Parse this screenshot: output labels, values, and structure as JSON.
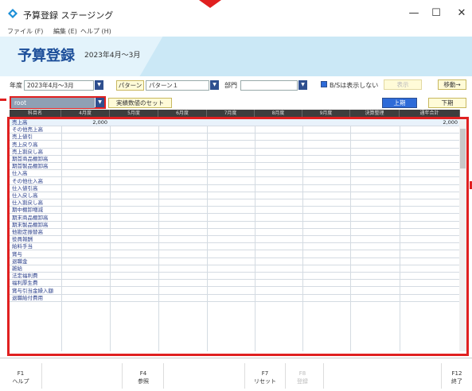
{
  "window": {
    "title": "予算登録 ステージング",
    "controls": {
      "minimize": "—",
      "maximize": "☐",
      "close": "✕"
    }
  },
  "menu": [
    {
      "label": "ファイル (F)"
    },
    {
      "label": "編集 (E)"
    },
    {
      "label": "ヘルプ (H)"
    }
  ],
  "header": {
    "title": "予算登録",
    "period": "2023年4月～3月"
  },
  "filters": {
    "year_label": "年度",
    "year_value": "2023年4月～3月",
    "pattern_label": "パターン",
    "pattern_value": "パターン１",
    "dept_label": "部門",
    "dept_value": "",
    "bs_hide_label": "B/Sは表示しない",
    "display_button": "表示",
    "move_button": "移動→"
  },
  "toolbar": {
    "tree_value": "root",
    "actual_set_button": "実績数値のセット",
    "upper_button": "上期",
    "lower_button": "下期"
  },
  "table": {
    "columns": [
      "科目名",
      "4月度",
      "5月度",
      "6月度",
      "7月度",
      "8月度",
      "9月度",
      "決算整理",
      "通年合計"
    ],
    "rows": [
      {
        "name": "売上高",
        "apr": "2,000",
        "total": "2,000"
      },
      {
        "name": "その他売上高",
        "apr": "",
        "total": ""
      },
      {
        "name": "売上値引",
        "apr": "",
        "total": ""
      },
      {
        "name": "売上戻り高",
        "apr": "",
        "total": ""
      },
      {
        "name": "売上割戻し高",
        "apr": "",
        "total": ""
      },
      {
        "name": "期首商品棚卸高",
        "apr": "",
        "total": ""
      },
      {
        "name": "期首製品棚卸高",
        "apr": "",
        "total": ""
      },
      {
        "name": "仕入高",
        "apr": "",
        "total": ""
      },
      {
        "name": "その他仕入高",
        "apr": "",
        "total": ""
      },
      {
        "name": "仕入値引高",
        "apr": "",
        "total": ""
      },
      {
        "name": "仕入戻し高",
        "apr": "",
        "total": ""
      },
      {
        "name": "仕入割戻し高",
        "apr": "",
        "total": ""
      },
      {
        "name": "期中棚卸増減",
        "apr": "",
        "total": ""
      },
      {
        "name": "期末商品棚卸高",
        "apr": "",
        "total": ""
      },
      {
        "name": "期末製品棚卸高",
        "apr": "",
        "total": ""
      },
      {
        "name": "他勘定振替高",
        "apr": "",
        "total": ""
      },
      {
        "name": "役員報酬",
        "apr": "",
        "total": ""
      },
      {
        "name": "給料手当",
        "apr": "",
        "total": ""
      },
      {
        "name": "賞与",
        "apr": "",
        "total": ""
      },
      {
        "name": "退職金",
        "apr": "",
        "total": ""
      },
      {
        "name": "雑給",
        "apr": "",
        "total": ""
      },
      {
        "name": "法定福利費",
        "apr": "",
        "total": ""
      },
      {
        "name": "福利厚生費",
        "apr": "",
        "total": ""
      },
      {
        "name": "賞与引当金繰入額",
        "apr": "",
        "total": ""
      },
      {
        "name": "退職給付費用",
        "apr": "",
        "total": ""
      }
    ]
  },
  "fkeys": {
    "f1_key": "F1",
    "f1_label": "ヘルプ",
    "f4_key": "F4",
    "f4_label": "参照",
    "f7_key": "F7",
    "f7_label": "リセット",
    "f8_key": "F8",
    "f8_label": "登録",
    "f12_key": "F12",
    "f12_label": "終了"
  },
  "colors": {
    "accent": "#1d4f9a",
    "highlight": "#e02020",
    "header_bg": "#3d3d3d",
    "dropdown": "#2e4f8f",
    "yellow_button": "#fffbd8",
    "banner": "#e3f3fb"
  }
}
